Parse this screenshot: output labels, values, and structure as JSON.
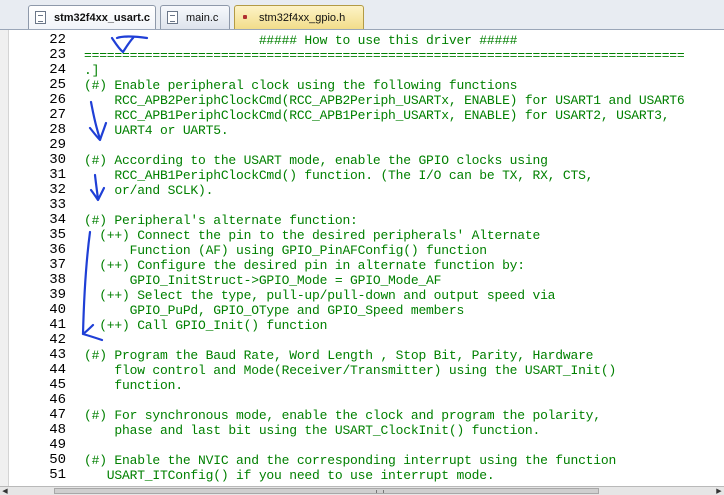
{
  "tabs": [
    {
      "label": "stm32f4xx_usart.c",
      "active": true,
      "icon": "c-file-icon"
    },
    {
      "label": "main.c",
      "active": false,
      "icon": "c-file-icon"
    },
    {
      "label": "stm32f4xx_gpio.h",
      "active": false,
      "icon": "h-file-icon"
    }
  ],
  "editor": {
    "lines": [
      {
        "num": "22",
        "text": "                       ##### How to use this driver #####"
      },
      {
        "num": "23",
        "text": "==============================================================================="
      },
      {
        "num": "24",
        "text": ".]"
      },
      {
        "num": "25",
        "text": "(#) Enable peripheral clock using the following functions"
      },
      {
        "num": "26",
        "text": "    RCC_APB2PeriphClockCmd(RCC_APB2Periph_USARTx, ENABLE) for USART1 and USART6"
      },
      {
        "num": "27",
        "text": "    RCC_APB1PeriphClockCmd(RCC_APB1Periph_USARTx, ENABLE) for USART2, USART3,"
      },
      {
        "num": "28",
        "text": "    UART4 or UART5."
      },
      {
        "num": "29",
        "text": ""
      },
      {
        "num": "30",
        "text": "(#) According to the USART mode, enable the GPIO clocks using"
      },
      {
        "num": "31",
        "text": "    RCC_AHB1PeriphClockCmd() function. (The I/O can be TX, RX, CTS,"
      },
      {
        "num": "32",
        "text": "    or/and SCLK)."
      },
      {
        "num": "33",
        "text": ""
      },
      {
        "num": "34",
        "text": "(#) Peripheral's alternate function:"
      },
      {
        "num": "35",
        "text": "  (++) Connect the pin to the desired peripherals' Alternate"
      },
      {
        "num": "36",
        "text": "      Function (AF) using GPIO_PinAFConfig() function"
      },
      {
        "num": "37",
        "text": "  (++) Configure the desired pin in alternate function by:"
      },
      {
        "num": "38",
        "text": "      GPIO_InitStruct->GPIO_Mode = GPIO_Mode_AF"
      },
      {
        "num": "39",
        "text": "  (++) Select the type, pull-up/pull-down and output speed via"
      },
      {
        "num": "40",
        "text": "      GPIO_PuPd, GPIO_OType and GPIO_Speed members"
      },
      {
        "num": "41",
        "text": "  (++) Call GPIO_Init() function"
      },
      {
        "num": "42",
        "text": ""
      },
      {
        "num": "43",
        "text": "(#) Program the Baud Rate, Word Length , Stop Bit, Parity, Hardware"
      },
      {
        "num": "44",
        "text": "    flow control and Mode(Receiver/Transmitter) using the USART_Init()"
      },
      {
        "num": "45",
        "text": "    function."
      },
      {
        "num": "46",
        "text": ""
      },
      {
        "num": "47",
        "text": "(#) For synchronous mode, enable the clock and program the polarity,"
      },
      {
        "num": "48",
        "text": "    phase and last bit using the USART_ClockInit() function."
      },
      {
        "num": "49",
        "text": ""
      },
      {
        "num": "50",
        "text": "(#) Enable the NVIC and the corresponding interrupt using the function"
      },
      {
        "num": "51",
        "text": "   USART_ITConfig() if you need to use interrupt mode."
      }
    ]
  },
  "colors": {
    "comment_text": "#008000",
    "line_numbers": "#000000",
    "pen_annotation": "#1f3fd6",
    "active_tab": "#ffffff",
    "modified_tab": "#f2dd8a"
  },
  "scrollbar": {
    "left_arrow_icon": "arrow-left-icon",
    "right_arrow_icon": "arrow-right-icon"
  }
}
